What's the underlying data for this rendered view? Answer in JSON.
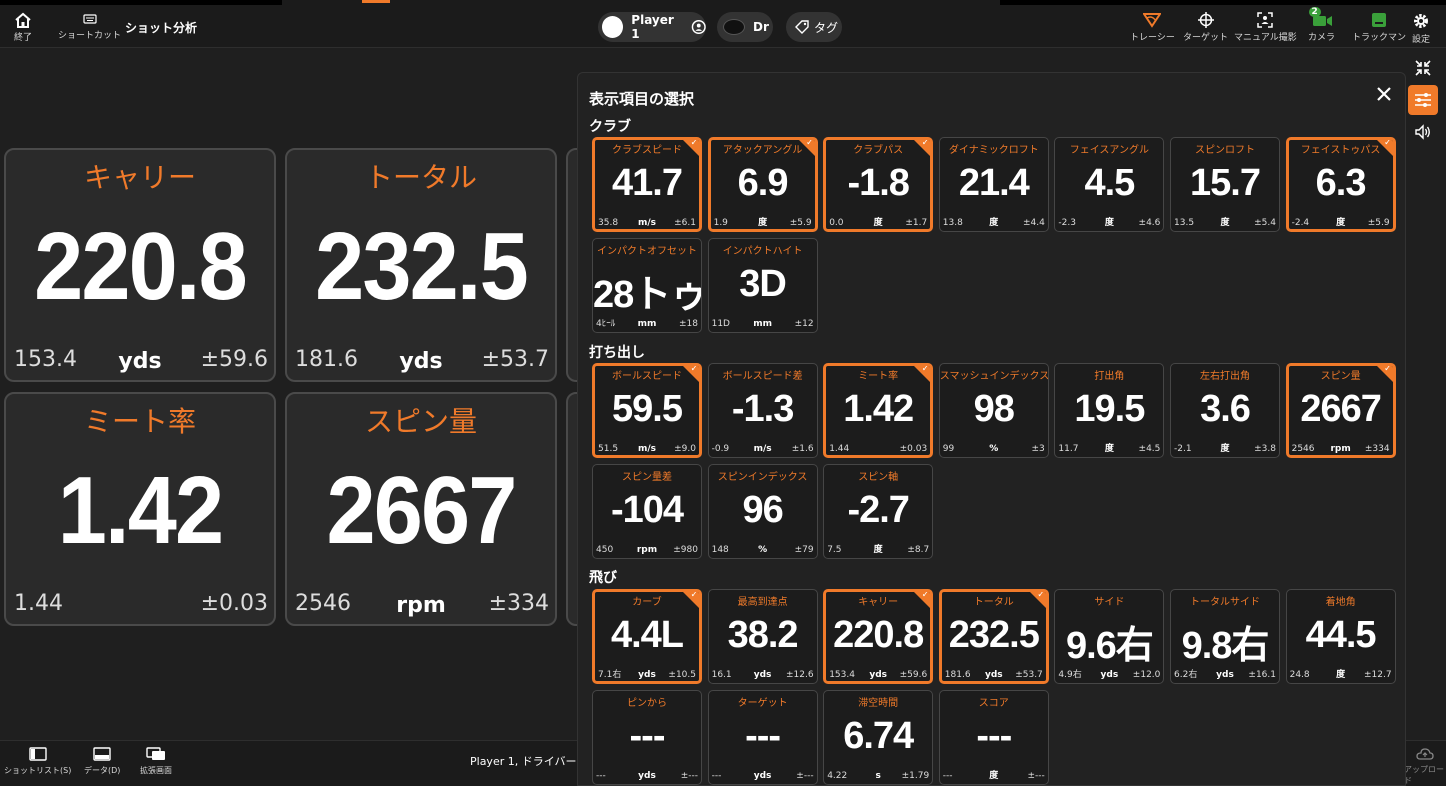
{
  "topbar": {
    "exit_label": "終了",
    "shortcut_label": "ショートカット",
    "title": "ショット分析",
    "player_label": "Player 1",
    "club_label": "Dr",
    "tag_label": "タグ",
    "tracer_label": "トレーシー",
    "target_label": "ターゲット",
    "manual_label": "マニュアル撮影",
    "camera_label": "カメラ",
    "camera_badge": "2",
    "trackman_label": "トラックマン",
    "settings_label": "設定"
  },
  "tiles": [
    {
      "title": "キャリー",
      "value": "220.8",
      "min": "153.4",
      "unit": "yds",
      "pm": "±59.6"
    },
    {
      "title": "トータル",
      "value": "232.5",
      "min": "181.6",
      "unit": "yds",
      "pm": "±53.7"
    },
    {
      "title": "ミート率",
      "value": "1.42",
      "min": "1.44",
      "unit": "",
      "pm": "±0.03"
    },
    {
      "title": "スピン量",
      "value": "2667",
      "min": "2546",
      "unit": "rpm",
      "pm": "±334"
    }
  ],
  "panel": {
    "title": "表示項目の選択",
    "sections": {
      "club": "クラブ",
      "launch": "打ち出し",
      "flight": "飛び"
    },
    "club_cells": [
      {
        "label": "クラブスピード",
        "value": "41.7",
        "min": "35.8",
        "unit": "m/s",
        "pm": "±6.1",
        "selected": true
      },
      {
        "label": "アタックアングル",
        "value": "6.9",
        "min": "1.9",
        "unit": "度",
        "pm": "±5.9",
        "selected": true
      },
      {
        "label": "クラブパス",
        "value": "-1.8",
        "min": "0.0",
        "unit": "度",
        "pm": "±1.7",
        "selected": true
      },
      {
        "label": "ダイナミックロフト",
        "value": "21.4",
        "min": "13.8",
        "unit": "度",
        "pm": "±4.4",
        "selected": false
      },
      {
        "label": "フェイスアングル",
        "value": "4.5",
        "min": "-2.3",
        "unit": "度",
        "pm": "±4.6",
        "selected": false
      },
      {
        "label": "スピンロフト",
        "value": "15.7",
        "min": "13.5",
        "unit": "度",
        "pm": "±5.4",
        "selected": false
      },
      {
        "label": "フェイストゥパス",
        "value": "6.3",
        "min": "-2.4",
        "unit": "度",
        "pm": "±5.9",
        "selected": true
      },
      {
        "label": "インパクトオフセット",
        "value": "28トゥ",
        "min": "4ﾋｰﾙ",
        "unit": "mm",
        "pm": "±18",
        "selected": false
      },
      {
        "label": "インパクトハイト",
        "value": "3D",
        "min": "11D",
        "unit": "mm",
        "pm": "±12",
        "selected": false
      }
    ],
    "launch_cells": [
      {
        "label": "ボールスピード",
        "value": "59.5",
        "min": "51.5",
        "unit": "m/s",
        "pm": "±9.0",
        "selected": true
      },
      {
        "label": "ボールスピード差",
        "value": "-1.3",
        "min": "-0.9",
        "unit": "m/s",
        "pm": "±1.6",
        "selected": false
      },
      {
        "label": "ミート率",
        "value": "1.42",
        "min": "1.44",
        "unit": "",
        "pm": "±0.03",
        "selected": true
      },
      {
        "label": "スマッシュインデックス",
        "value": "98",
        "min": "99",
        "unit": "%",
        "pm": "±3",
        "selected": false
      },
      {
        "label": "打出角",
        "value": "19.5",
        "min": "11.7",
        "unit": "度",
        "pm": "±4.5",
        "selected": false
      },
      {
        "label": "左右打出角",
        "value": "3.6",
        "min": "-2.1",
        "unit": "度",
        "pm": "±3.8",
        "selected": false
      },
      {
        "label": "スピン量",
        "value": "2667",
        "min": "2546",
        "unit": "rpm",
        "pm": "±334",
        "selected": true
      },
      {
        "label": "スピン量差",
        "value": "-104",
        "min": "450",
        "unit": "rpm",
        "pm": "±980",
        "selected": false
      },
      {
        "label": "スピンインデックス",
        "value": "96",
        "min": "148",
        "unit": "%",
        "pm": "±79",
        "selected": false
      },
      {
        "label": "スピン軸",
        "value": "-2.7",
        "min": "7.5",
        "unit": "度",
        "pm": "±8.7",
        "selected": false
      }
    ],
    "flight_cells": [
      {
        "label": "カーブ",
        "value": "4.4L",
        "min": "7.1右",
        "unit": "yds",
        "pm": "±10.5",
        "selected": true
      },
      {
        "label": "最高到達点",
        "value": "38.2",
        "min": "16.1",
        "unit": "yds",
        "pm": "±12.6",
        "selected": false
      },
      {
        "label": "キャリー",
        "value": "220.8",
        "min": "153.4",
        "unit": "yds",
        "pm": "±59.6",
        "selected": true
      },
      {
        "label": "トータル",
        "value": "232.5",
        "min": "181.6",
        "unit": "yds",
        "pm": "±53.7",
        "selected": true
      },
      {
        "label": "サイド",
        "value": "9.6右",
        "min": "4.9右",
        "unit": "yds",
        "pm": "±12.0",
        "selected": false
      },
      {
        "label": "トータルサイド",
        "value": "9.8右",
        "min": "6.2右",
        "unit": "yds",
        "pm": "±16.1",
        "selected": false
      },
      {
        "label": "着地角",
        "value": "44.5",
        "min": "24.8",
        "unit": "度",
        "pm": "±12.7",
        "selected": false
      },
      {
        "label": "ピンから",
        "value": "---",
        "min": "---",
        "unit": "yds",
        "pm": "±---",
        "selected": false
      },
      {
        "label": "ターゲット",
        "value": "---",
        "min": "---",
        "unit": "yds",
        "pm": "±---",
        "selected": false
      },
      {
        "label": "滞空時間",
        "value": "6.74",
        "min": "4.22",
        "unit": "s",
        "pm": "±1.79",
        "selected": false
      },
      {
        "label": "スコア",
        "value": "---",
        "min": "---",
        "unit": "度",
        "pm": "±---",
        "selected": false
      }
    ]
  },
  "bottombar": {
    "shotlist_label": "ショットリスト(S)",
    "data_label": "データ(D)",
    "expand_label": "拡張画面",
    "status": "Player 1, ドライバー,",
    "upload_label": "アップロード"
  },
  "colors": {
    "accent": "#f07a2a",
    "panel_bg": "#222222",
    "cell_bg": "#1c1c1c"
  }
}
